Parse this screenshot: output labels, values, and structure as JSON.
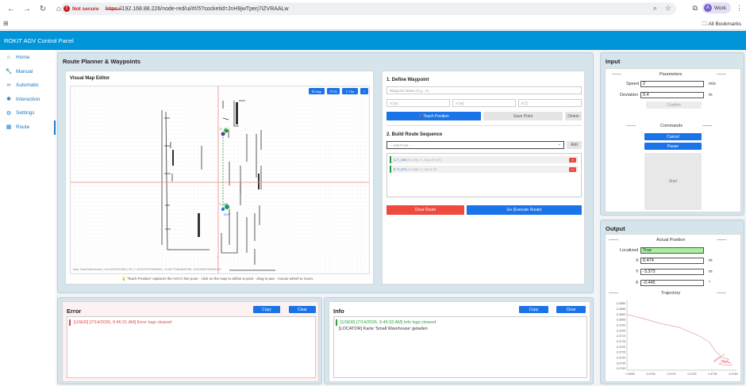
{
  "browser": {
    "not_secure": "Not secure",
    "url_scheme": "https://",
    "url_rest": "192.168.88.226/node-red/ui/#!/5?socketid=JnH9jwTperj7iZVRAALw",
    "profile_name": "Work",
    "profile_initial": "A",
    "bookmarks_label": "All Bookmarks"
  },
  "app": {
    "title": "ROKIT AGV Control Panel"
  },
  "sidebar": {
    "items": [
      {
        "label": "Home",
        "icon": "home-icon"
      },
      {
        "label": "Manual",
        "icon": "wrench-icon"
      },
      {
        "label": "Automatic",
        "icon": "infinity-icon"
      },
      {
        "label": "Interaction",
        "icon": "puzzle-icon"
      },
      {
        "label": "Settings",
        "icon": "gear-icon"
      },
      {
        "label": "Route",
        "icon": "grid-icon"
      }
    ]
  },
  "route_planner": {
    "title": "Route Planner & Waypoints",
    "editor_title": "Visual Map Editor",
    "map_buttons": [
      "Map",
      "Fit",
      "File",
      "+"
    ],
    "status_line": "Map: Small Warehouse | 4.6144294372950 | 90 | 7.4479070270269546 | -13.667726446699785, -8.6245487493354415",
    "hint": "'Teach Position' captures the AGV's live pose · click on the map to define a point · drag to pan · mouse wheel to zoom.",
    "agv_label": "AGV",
    "markers": [
      {
        "label": "P_872"
      },
      {
        "label": "T_496"
      }
    ]
  },
  "define_waypoint": {
    "title": "1. Define Waypoint",
    "name_placeholder": "Waypoint Name (e.g., A)",
    "x_placeholder": "X [m]",
    "y_placeholder": "Y [m]",
    "theta_placeholder": "θ [°]",
    "teach_label": "Teach Position",
    "save_label": "Save Point",
    "delete_label": "Delete"
  },
  "route_sequence": {
    "title": "2. Build Route Sequence",
    "select_placeholder": "-- Add Point --",
    "add_label": "Add",
    "items": [
      {
        "index": "1.",
        "name": "T_496",
        "detail": "(X: 0.000, Y: -3.xxx, θ: 0.0°)"
      },
      {
        "index": "2.",
        "name": "P_872",
        "detail": "(X: 0.484, Y: 1.34, θ: 0°)"
      }
    ],
    "clear_label": "Clear Route",
    "go_label": "Go (Execute Route)"
  },
  "error_panel": {
    "title": "Error",
    "copy_label": "Copy",
    "clear_label": "Clear",
    "lines": [
      "[USER] [7/14/2026, 9:46:31 AM] Error logs cleared"
    ]
  },
  "info_panel": {
    "title": "Info",
    "copy_label": "Copy",
    "clear_label": "Clear",
    "lines": [
      "[USER] [7/14/2026, 9:46:32 AM] Info logs cleared",
      "[LOCATOR] Karte 'Small Warehouse' geladen"
    ]
  },
  "input_panel": {
    "title": "Input",
    "parameters_label": "Parameters",
    "speed_label": "Speed",
    "speed_value": "2",
    "speed_unit": "m/s",
    "deviation_label": "Deviation",
    "deviation_value": "0.4",
    "deviation_unit": "m",
    "confirm_label": "Confirm",
    "commands_label": "Commands",
    "cancel_label": "Cancel",
    "pause_label": "Pause",
    "start_label": "Start",
    "dashes": "----------"
  },
  "output_panel": {
    "title": "Output",
    "actual_position_label": "Actual Position",
    "localized_label": "Localized",
    "localized_value": "True",
    "x_label": "X",
    "x_value": "0.474",
    "x_unit": "m",
    "y_label": "Y",
    "y_value": "-3.373",
    "y_unit": "m",
    "theta_label": "θ",
    "theta_value": "-0.445",
    "theta_unit": "°",
    "trajectory_label": "Trajectory",
    "dashes": "----------"
  },
  "chart_data": {
    "type": "line",
    "title": "",
    "xlabel": "",
    "ylabel": "",
    "xlim": [
      0.4695,
      0.4752
    ],
    "ylim": [
      -3.3745,
      -3.3675
    ],
    "x_ticks": [
      "0.4695",
      "0.4705",
      "0.4715",
      "0.4725",
      "0.4735",
      "0.4745"
    ],
    "y_ticks": [
      "-3.3680",
      "-3.3685",
      "-3.3690",
      "-3.3695",
      "-3.3700",
      "-3.3705",
      "-3.3710",
      "-3.3715",
      "-3.3720",
      "-3.3725",
      "-3.3730",
      "-3.3735",
      "-3.3740"
    ],
    "series": [
      {
        "x": [
          0.4695,
          0.4703,
          0.4712,
          0.4722,
          0.4732,
          0.4738,
          0.4741,
          0.4744,
          0.4746,
          0.4742,
          0.474,
          0.4744,
          0.4748,
          0.4746,
          0.4744,
          0.4747,
          0.4749,
          0.4745,
          0.4743,
          0.4747,
          0.475
        ],
        "y": [
          -3.3689,
          -3.3693,
          -3.3698,
          -3.3702,
          -3.371,
          -3.3717,
          -3.3726,
          -3.3731,
          -3.3729,
          -3.3733,
          -3.3737,
          -3.3732,
          -3.3734,
          -3.3738,
          -3.3735,
          -3.3736,
          -3.3738,
          -3.3736,
          -3.3739,
          -3.374,
          -3.374
        ],
        "color": "#e8888f"
      }
    ],
    "grid": false
  },
  "colors": {
    "header": "#0094d9",
    "accent": "#1a73e8",
    "danger": "#ee4b3e",
    "localized": "#a8f0a0"
  }
}
